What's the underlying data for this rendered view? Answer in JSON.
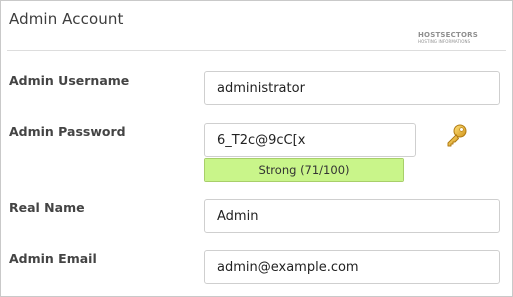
{
  "panel": {
    "title": "Admin Account",
    "watermark": {
      "top": "HOSTSECTORS",
      "bottom": "HOSTING INFORMATIONS"
    }
  },
  "fields": {
    "username": {
      "label": "Admin Username",
      "value": "administrator"
    },
    "password": {
      "label": "Admin Password",
      "value": "6_T2c@9cC[x",
      "strength": {
        "text": "Strong (71/100)",
        "score": 71,
        "max": 100,
        "color": "#c9f58a"
      }
    },
    "real_name": {
      "label": "Real Name",
      "value": "Admin"
    },
    "email": {
      "label": "Admin Email",
      "value": "admin@example.com"
    }
  },
  "icons": {
    "generate_password": "key-icon"
  },
  "colors": {
    "key_icon": "#e0a526"
  }
}
